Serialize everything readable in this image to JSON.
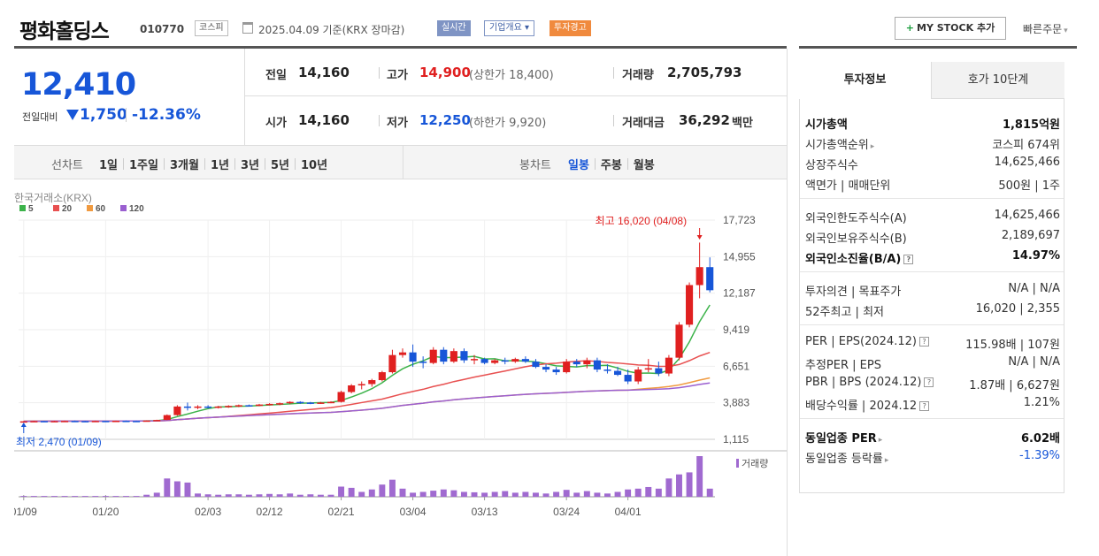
{
  "header": {
    "title": "평화홀딩스",
    "code": "010770",
    "market": "코스피",
    "date_text": "2025.04.09 기준(KRX 장마감)",
    "badge_realtime": "실시간",
    "badge_corp": "기업개요",
    "badge_warn": "투자경고",
    "mystock": "MY STOCK 추가",
    "mystock_plus": "+",
    "quick": "빠른주문"
  },
  "price": {
    "current": "12,410",
    "cmp_label": "전일대비",
    "change": "1,750",
    "change_pct": "-12.36%",
    "prev_label": "전일",
    "prev": "14,160",
    "open_label": "시가",
    "open": "14,160",
    "high_label": "고가",
    "high": "14,900",
    "upper_label": "(상한가 18,400)",
    "low_label": "저가",
    "low": "12,250",
    "lower_label": "(하한가 9,920)",
    "vol_label": "거래량",
    "vol": "2,705,793",
    "amt_label": "거래대금",
    "amt": "36,292",
    "amt_unit": "백만"
  },
  "tabs": {
    "line_label": "선차트",
    "line": [
      "1일",
      "1주일",
      "3개월",
      "1년",
      "3년",
      "5년",
      "10년"
    ],
    "candle_label": "봉차트",
    "candle": [
      "일봉",
      "주봉",
      "월봉"
    ],
    "active": "일봉"
  },
  "chart_data": {
    "type": "candlestick",
    "source": "한국거래소(KRX)",
    "ma": [
      {
        "name": "5",
        "color": "#3cb34a"
      },
      {
        "name": "20",
        "color": "#e85050"
      },
      {
        "name": "60",
        "color": "#f09a40"
      },
      {
        "name": "120",
        "color": "#9a5fd0"
      }
    ],
    "yticks": [
      "17,723",
      "14,955",
      "12,187",
      "9,419",
      "6,651",
      "3,883",
      "1,115"
    ],
    "ylim": [
      1115,
      17723
    ],
    "xticks": [
      "01/09",
      "01/20",
      "02/03",
      "02/12",
      "02/21",
      "03/04",
      "03/13",
      "03/24",
      "04/01"
    ],
    "high_note": "최고 16,020 (04/08)",
    "low_note": "최저 2,470 (01/09)",
    "vol_label": "거래량",
    "candles": [
      [
        2470,
        2500,
        2450,
        2480
      ],
      [
        2480,
        2520,
        2460,
        2500
      ],
      [
        2500,
        2510,
        2470,
        2490
      ],
      [
        2490,
        2520,
        2480,
        2500
      ],
      [
        2500,
        2530,
        2480,
        2510
      ],
      [
        2510,
        2540,
        2490,
        2500
      ],
      [
        2500,
        2520,
        2470,
        2490
      ],
      [
        2490,
        2530,
        2480,
        2510
      ],
      [
        2510,
        2520,
        2480,
        2500
      ],
      [
        2500,
        2530,
        2490,
        2520
      ],
      [
        2520,
        2540,
        2500,
        2510
      ],
      [
        2510,
        2530,
        2490,
        2500
      ],
      [
        2500,
        2550,
        2490,
        2540
      ],
      [
        2540,
        2600,
        2520,
        2580
      ],
      [
        2580,
        3000,
        2560,
        2950
      ],
      [
        2950,
        3700,
        2900,
        3600
      ],
      [
        3600,
        3900,
        3300,
        3500
      ],
      [
        3500,
        3700,
        3400,
        3600
      ],
      [
        3600,
        3700,
        3450,
        3550
      ],
      [
        3550,
        3650,
        3450,
        3600
      ],
      [
        3600,
        3700,
        3500,
        3650
      ],
      [
        3650,
        3750,
        3550,
        3700
      ],
      [
        3700,
        3750,
        3600,
        3680
      ],
      [
        3680,
        3800,
        3620,
        3750
      ],
      [
        3750,
        3850,
        3680,
        3800
      ],
      [
        3800,
        3900,
        3700,
        3850
      ],
      [
        3850,
        4000,
        3780,
        3950
      ],
      [
        3950,
        4000,
        3800,
        3900
      ],
      [
        3900,
        3950,
        3780,
        3850
      ],
      [
        3850,
        3950,
        3800,
        3900
      ],
      [
        3900,
        4000,
        3850,
        3950
      ],
      [
        3950,
        4800,
        3900,
        4700
      ],
      [
        4700,
        5300,
        4600,
        5200
      ],
      [
        5200,
        5500,
        4900,
        5300
      ],
      [
        5300,
        5700,
        5100,
        5600
      ],
      [
        5600,
        6300,
        5500,
        6200
      ],
      [
        6200,
        7900,
        6100,
        7500
      ],
      [
        7500,
        8000,
        7300,
        7700
      ],
      [
        7700,
        8300,
        6600,
        7000
      ],
      [
        7000,
        7400,
        6500,
        6900
      ],
      [
        6900,
        8100,
        6800,
        7900
      ],
      [
        7900,
        8100,
        6800,
        7000
      ],
      [
        7000,
        8000,
        6900,
        7800
      ],
      [
        7800,
        8000,
        6900,
        7100
      ],
      [
        7100,
        7500,
        6800,
        7200
      ],
      [
        7200,
        7300,
        6800,
        6900
      ],
      [
        6900,
        7200,
        6800,
        7100
      ],
      [
        7100,
        7300,
        6800,
        7000
      ],
      [
        7000,
        7300,
        6900,
        7200
      ],
      [
        7200,
        7400,
        6900,
        7000
      ],
      [
        7000,
        7200,
        6500,
        6600
      ],
      [
        6600,
        6800,
        6200,
        6400
      ],
      [
        6400,
        6600,
        6000,
        6200
      ],
      [
        6200,
        7200,
        6100,
        7000
      ],
      [
        7000,
        7200,
        6600,
        6800
      ],
      [
        6800,
        7300,
        6500,
        7100
      ],
      [
        7100,
        7300,
        6200,
        6400
      ],
      [
        6400,
        6800,
        6100,
        6300
      ],
      [
        6300,
        6600,
        5900,
        6000
      ],
      [
        6000,
        6400,
        5300,
        5500
      ],
      [
        5500,
        6600,
        5300,
        6400
      ],
      [
        6400,
        7200,
        6200,
        6500
      ],
      [
        6500,
        7000,
        5900,
        6100
      ],
      [
        6100,
        7500,
        5900,
        7300
      ],
      [
        7300,
        10000,
        7100,
        9800
      ],
      [
        9800,
        13000,
        9600,
        12800
      ],
      [
        12800,
        16020,
        11800,
        14160
      ],
      [
        14160,
        14900,
        12250,
        12410
      ]
    ],
    "volumes": [
      0.02,
      0.02,
      0.02,
      0.02,
      0.02,
      0.02,
      0.02,
      0.02,
      0.02,
      0.02,
      0.02,
      0.02,
      0.05,
      0.1,
      0.45,
      0.38,
      0.35,
      0.08,
      0.06,
      0.05,
      0.06,
      0.06,
      0.05,
      0.06,
      0.07,
      0.06,
      0.08,
      0.05,
      0.06,
      0.05,
      0.05,
      0.25,
      0.22,
      0.12,
      0.18,
      0.3,
      0.42,
      0.2,
      0.1,
      0.12,
      0.15,
      0.18,
      0.16,
      0.12,
      0.11,
      0.1,
      0.12,
      0.14,
      0.1,
      0.12,
      0.1,
      0.08,
      0.12,
      0.17,
      0.1,
      0.14,
      0.1,
      0.08,
      0.12,
      0.18,
      0.2,
      0.24,
      0.2,
      0.45,
      0.55,
      0.6,
      1.0,
      0.2
    ]
  },
  "side": {
    "tab1": "투자정보",
    "tab2": "호가 10단계",
    "rows1": [
      [
        "시가총액",
        "1,815억원"
      ],
      [
        "시가총액순위",
        "코스피 674위"
      ],
      [
        "상장주식수",
        "14,625,466"
      ],
      [
        "액면가 | 매매단위",
        "500원 | 1주"
      ]
    ],
    "rows2": [
      [
        "외국인한도주식수(A)",
        "14,625,466"
      ],
      [
        "외국인보유주식수(B)",
        "2,189,697"
      ],
      [
        "외국인소진율(B/A)",
        "14.97%"
      ]
    ],
    "rows3": [
      [
        "투자의견 | 목표주가",
        "N/A | N/A"
      ],
      [
        "52주최고 | 최저",
        "16,020 | 2,355"
      ]
    ],
    "rows4": [
      [
        "PER | EPS(2024.12)",
        "115.98배 | 107원"
      ],
      [
        "추정PER | EPS",
        "N/A | N/A"
      ],
      [
        "PBR | BPS (2024.12)",
        "1.87배 | 6,627원"
      ],
      [
        "배당수익률 | 2024.12",
        "1.21%"
      ]
    ],
    "rows5": [
      [
        "동일업종 PER",
        "6.02배"
      ],
      [
        "동일업종 등락률",
        "-1.39%"
      ]
    ]
  }
}
